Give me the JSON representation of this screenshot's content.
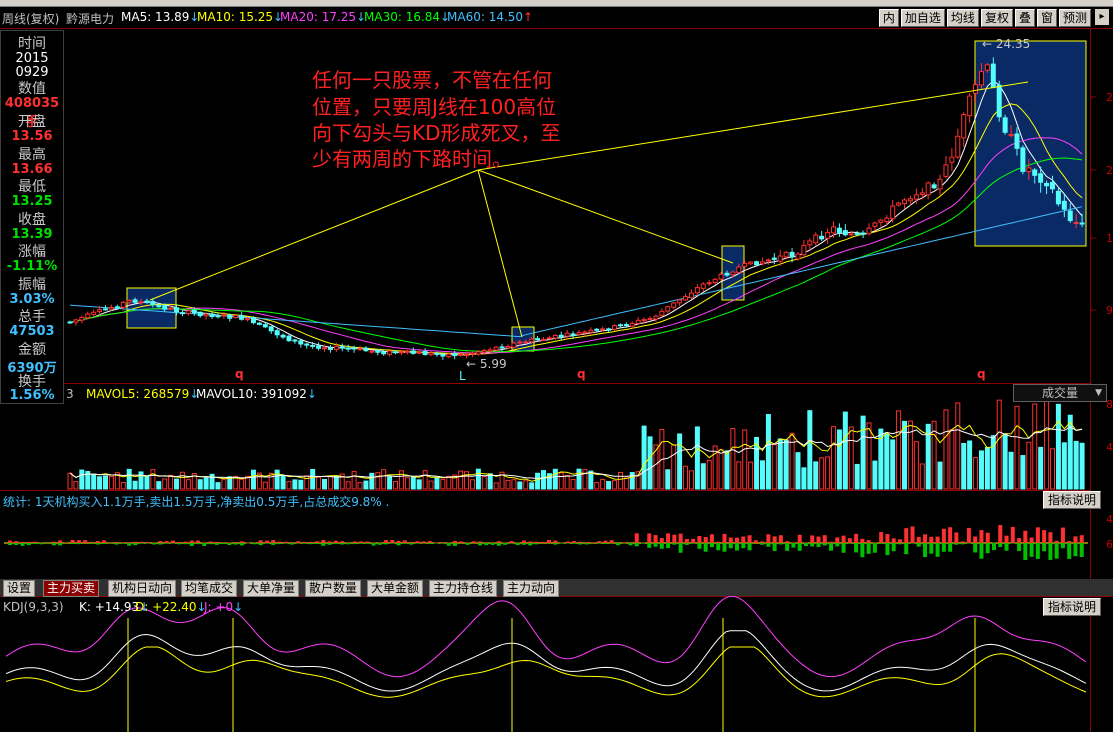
{
  "header": {
    "period": "周线(复权)",
    "stock_name": "黔源电力",
    "ma": [
      {
        "label": "MA5: 13.89",
        "arrow": "↓",
        "color": "#ffffff"
      },
      {
        "label": "MA10: 15.25",
        "arrow": "↓",
        "color": "#ffff00"
      },
      {
        "label": "MA20: 17.25",
        "arrow": "↓",
        "color": "#ff40ff"
      },
      {
        "label": "MA30: 16.84",
        "arrow": "↓",
        "color": "#00ff00"
      },
      {
        "label": "MA60: 14.50",
        "arrow": "↑",
        "color": "#40c0ff"
      }
    ]
  },
  "toolbar": [
    "内",
    "加自选",
    "均线",
    "复权",
    "叠",
    "窗",
    "预测"
  ],
  "data_window": {
    "time_label": "时间",
    "time_year": "2015",
    "time_md": "0929",
    "value_label": "数值",
    "value": "408035手",
    "open_label": "开盘",
    "open": "13.56",
    "high_label": "最高",
    "high": "13.66",
    "low_label": "最低",
    "low": "13.25",
    "close_label": "收盘",
    "close": "13.39",
    "change_label": "涨幅",
    "change": "-1.11%",
    "amplitude_label": "振幅",
    "amplitude": "3.03%",
    "volume_label": "总手",
    "volume": "47503",
    "amount_label": "金额",
    "amount": "6390万",
    "turnover_label": "换手",
    "turnover": "1.56%"
  },
  "annotation": {
    "line1": "任何一只股票，不管在任何",
    "line2": "位置，只要周J线在100高位",
    "line3": "向下勾头与KD形成死叉，至",
    "line4": "少有两周的下路时间。"
  },
  "price_labels": {
    "high": "24.35",
    "low": "5.99",
    "low_marker": "L",
    "q_marker": "q"
  },
  "right_axis": {
    "main": [
      "2",
      "2",
      "1",
      "1",
      "9"
    ],
    "vol": [
      "8",
      "4"
    ],
    "fund": [
      "4",
      "6"
    ]
  },
  "volume_panel": {
    "prefix": "3",
    "mavol5": "MAVOL5: 268579",
    "mavol10": "MAVOL10: 391092",
    "selector": "成交量",
    "arrow": "↓"
  },
  "stat_panel": {
    "text": "统计: 1天机构买入1.1万手,卖出1.5万手,净卖出0.5万手,占总成交9.8% .",
    "help": "指标说明"
  },
  "tabs": [
    "设置",
    "主力买卖",
    "机构日动向",
    "均笔成交",
    "大单净量",
    "散户数量",
    "大单金额",
    "主力持仓线",
    "主力动向"
  ],
  "kdj_panel": {
    "name": "KDJ(9,3,3)",
    "k": "K: +14.93",
    "d": "D: +22.40",
    "j": "J: +0",
    "help": "指标说明"
  },
  "colors": {
    "up": "#ff3030",
    "down": "#54fcfc",
    "annotation": "#ff2020",
    "guide": "#ffff00",
    "box": "#0a2a66"
  }
}
